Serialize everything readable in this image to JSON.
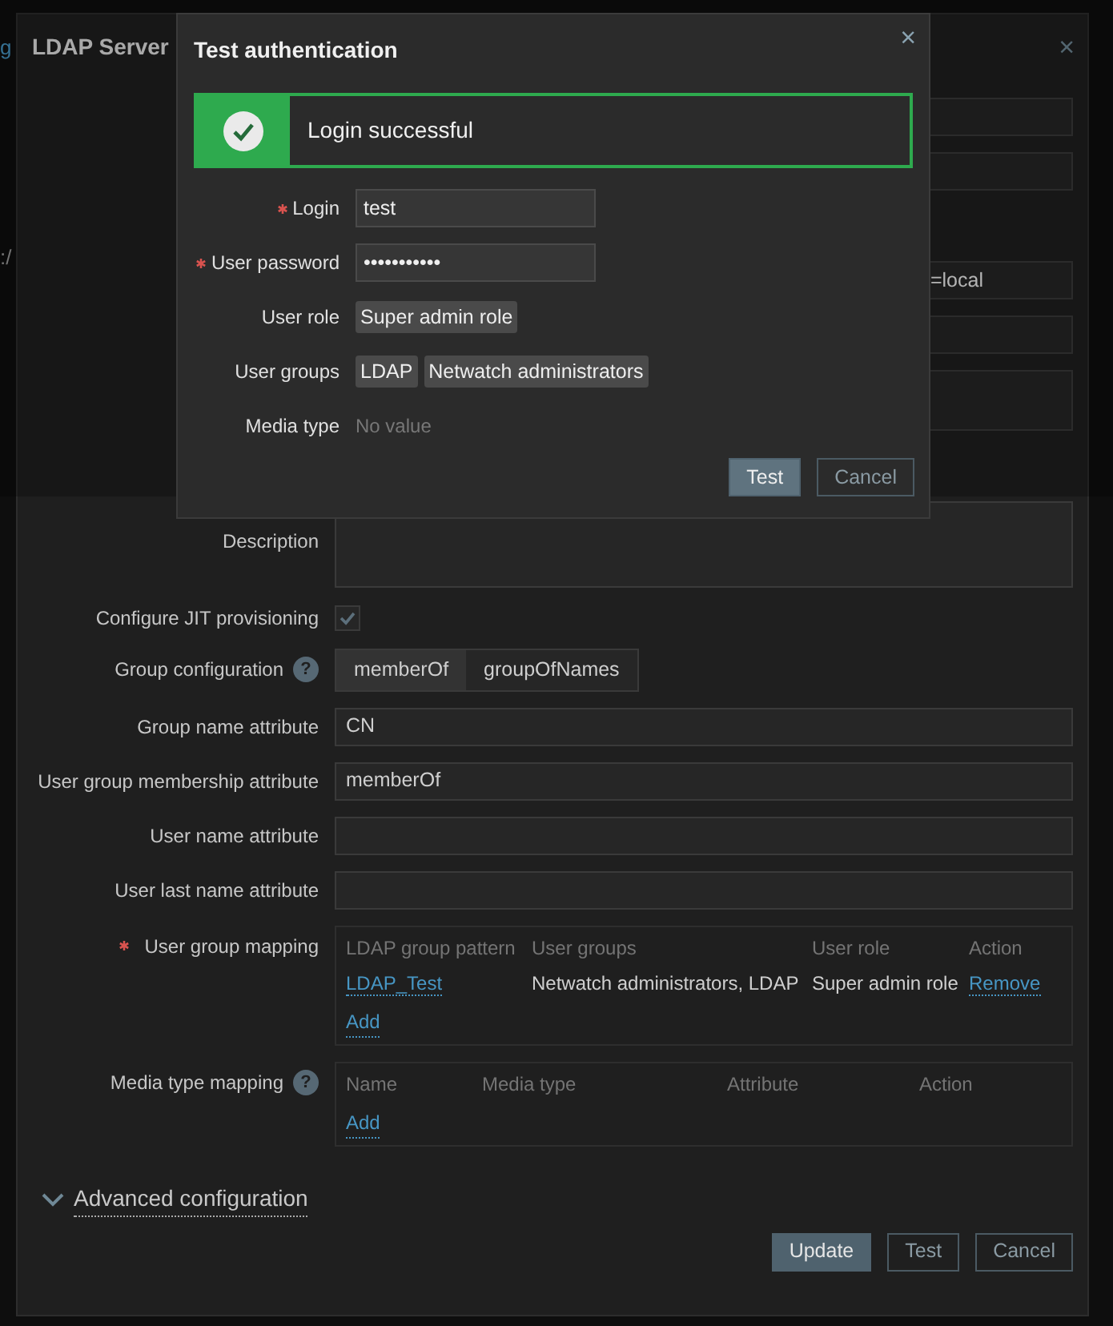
{
  "page_fragments": [
    {
      "kind": "link",
      "text": "g"
    },
    {
      "kind": "text",
      "text": ":/"
    }
  ],
  "dialog": {
    "title": "LDAP Server",
    "close": "×",
    "fields": [
      {
        "kind": "input"
      },
      {
        "kind": "input"
      },
      {
        "kind": "input",
        "value": "=local"
      },
      {
        "kind": "input"
      },
      {
        "kind": "textarea"
      },
      {
        "kind": "textarea",
        "label": "Description"
      },
      {
        "kind": "checkbox",
        "label": "Configure JIT provisioning",
        "checked": true
      },
      {
        "kind": "segmented",
        "label": "Group configuration",
        "help": "?",
        "options": [
          {
            "label": "memberOf",
            "selected": true
          },
          {
            "label": "groupOfNames",
            "selected": false
          }
        ]
      },
      {
        "kind": "input",
        "label": "Group name attribute",
        "value": "CN"
      },
      {
        "kind": "input",
        "label": "User group membership attribute",
        "value": "memberOf"
      },
      {
        "kind": "input",
        "label": "User name attribute"
      },
      {
        "kind": "input",
        "label": "User last name attribute"
      },
      {
        "kind": "mapping",
        "label": "User group mapping",
        "required": true,
        "columns": [
          "LDAP group pattern",
          "User groups",
          "User role",
          "Action"
        ],
        "rows": [
          {
            "cells": [
              "LDAP_Test",
              "Netwatch administrators, LDAP",
              "Super admin role",
              "Remove"
            ]
          }
        ],
        "add": "Add"
      },
      {
        "kind": "mapping",
        "label": "Media type mapping",
        "help": "?",
        "columns": [
          "Name",
          "Media type",
          "Attribute",
          "Action"
        ],
        "add": "Add"
      }
    ],
    "advanced": {
      "label": "Advanced configuration"
    },
    "buttons": [
      {
        "label": "Update",
        "primary": true
      },
      {
        "label": "Test",
        "primary": false
      },
      {
        "label": "Cancel",
        "primary": false
      }
    ]
  },
  "modal": {
    "title": "Test authentication",
    "close": "×",
    "alert": {
      "kind": "success",
      "message": "Login successful"
    },
    "rows": [
      {
        "kind": "input",
        "label": "Login",
        "required": true,
        "value": "test"
      },
      {
        "kind": "input",
        "label": "User password",
        "required": true,
        "value": "•••••••••••"
      },
      {
        "kind": "tags",
        "label": "User role",
        "tags": [
          "Super admin role"
        ]
      },
      {
        "kind": "tags",
        "label": "User groups",
        "tags": [
          "LDAP",
          "Netwatch administrators"
        ]
      },
      {
        "kind": "empty",
        "label": "Media type",
        "value": "No value"
      }
    ],
    "buttons": [
      {
        "label": "Test",
        "primary": true
      },
      {
        "label": "Cancel",
        "primary": false
      }
    ]
  }
}
